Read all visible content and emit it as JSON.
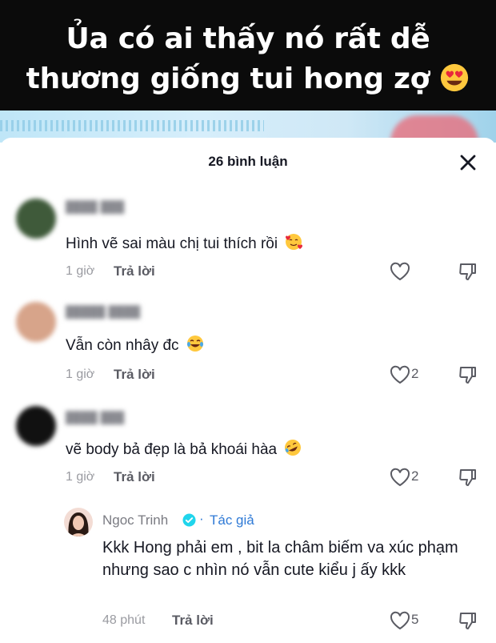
{
  "video": {
    "caption_line1": "Ủa có ai thấy nó rất dễ",
    "caption_line2": "thương giống tui hong zợ",
    "caption_emoji": "heart-eyes-emoji"
  },
  "sheet": {
    "title": "26 bình luận",
    "close_icon": "close-icon"
  },
  "comments": [
    {
      "text": "Hình vẽ sai màu chị tui thích rồi",
      "emoji": "smiling-face-with-hearts-emoji",
      "time": "1 giờ",
      "reply_label": "Trả lời",
      "likes": "",
      "avatar_color": "#3f5a3a"
    },
    {
      "text": "Vẫn còn nhây đc",
      "emoji": "tears-of-joy-emoji",
      "time": "1 giờ",
      "reply_label": "Trả lời",
      "likes": "2",
      "avatar_color": "#d7a48a"
    },
    {
      "text": "vẽ body bả đẹp là bả khoái hàa",
      "emoji": "rolling-on-floor-laughing-emoji",
      "time": "1 giờ",
      "reply_label": "Trả lời",
      "likes": "2",
      "avatar_color": "#111111"
    }
  ],
  "reply": {
    "name": "Ngoc Trinh",
    "dot": "·",
    "author_tag": "Tác giả",
    "text": "Kkk Hong phải em , bit la châm biếm va xúc phạm nhưng sao c nhìn nó vẫn cute kiểu j ấy kkk",
    "time": "48 phút",
    "reply_label": "Trả lời",
    "likes": "5"
  },
  "colors": {
    "accent": "#2f7ad6",
    "text": "#161823",
    "muted": "#9a9ba1"
  }
}
